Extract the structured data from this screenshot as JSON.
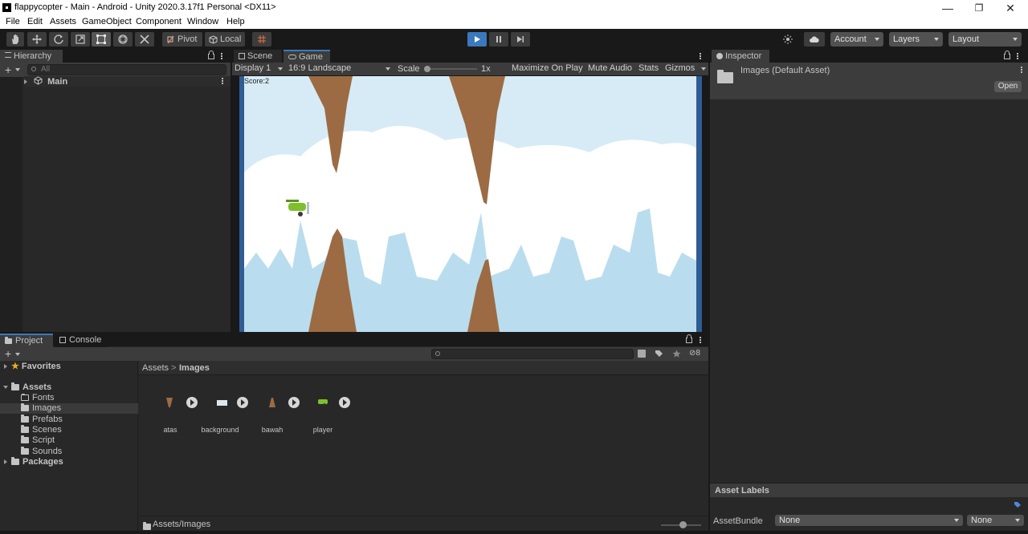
{
  "window": {
    "title": "flappycopter - Main - Android - Unity 2020.3.17f1 Personal <DX11>",
    "minimize": "—",
    "restore": "❐",
    "close": "✕"
  },
  "menu": [
    "File",
    "Edit",
    "Assets",
    "GameObject",
    "Component",
    "Window",
    "Help"
  ],
  "toolbar": {
    "pivot_label": "Pivot",
    "local_label": "Local",
    "account_label": "Account",
    "layers_label": "Layers",
    "layout_label": "Layout",
    "accent": "#3a79bb"
  },
  "hierarchy": {
    "tab_label": "Hierarchy",
    "search_placeholder": "All",
    "scene_name": "Main"
  },
  "game_view": {
    "tabs": [
      "Scene",
      "Game"
    ],
    "display": "Display 1",
    "aspect": "16:9 Landscape",
    "scale_label": "Scale",
    "scale_value": "1x",
    "maximize": "Maximize On Play",
    "mute": "Mute Audio",
    "stats": "Stats",
    "gizmos": "Gizmos",
    "score_text": "Score:2",
    "sky_color": "#d6ebf6",
    "rock_color": "#9c6b43"
  },
  "inspector": {
    "tab_label": "Inspector",
    "asset_title": "Images (Default Asset)",
    "open_button": "Open",
    "asset_labels_header": "Asset Labels",
    "assetbundle_label": "AssetBundle",
    "assetbundle_value": "None",
    "variant_value": "None"
  },
  "project": {
    "tabs": [
      "Project",
      "Console"
    ],
    "hidden_count": "8",
    "favorites": "Favorites",
    "tree_root": "Assets",
    "tree_children": [
      "Fonts",
      "Images",
      "Prefabs",
      "Scenes",
      "Script",
      "Sounds"
    ],
    "packages": "Packages",
    "breadcrumb": [
      "Assets",
      "Images"
    ],
    "breadcrumb_sep": ">",
    "assets": [
      {
        "name": "atas"
      },
      {
        "name": "background"
      },
      {
        "name": "bawah"
      },
      {
        "name": "player"
      }
    ],
    "footer_path": "Assets/Images"
  }
}
